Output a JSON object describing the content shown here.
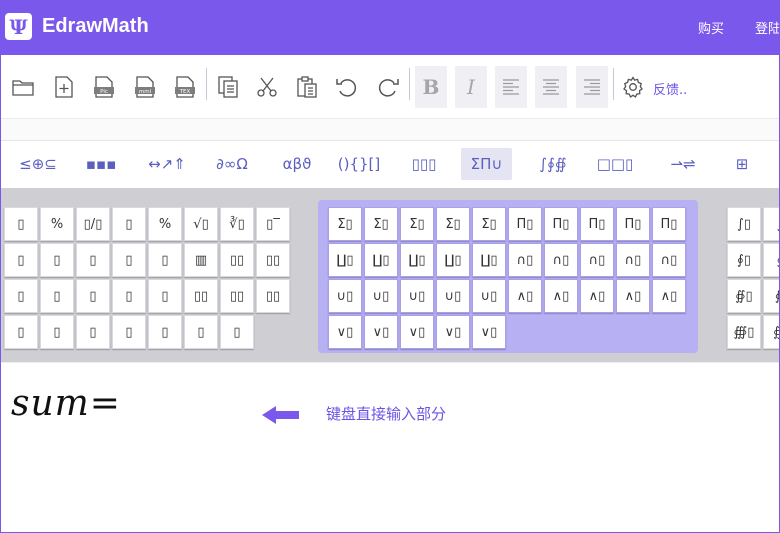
{
  "header": {
    "logo_glyph": "Ψ",
    "title": "EdrawMath",
    "buy_label": "购买",
    "login_label": "登陆",
    "accent": "#7b58ec"
  },
  "toolbar": {
    "icons": [
      "folder-icon",
      "new-file-icon",
      "export-pic-icon",
      "export-mml-icon",
      "export-tex-icon",
      "copy-icon",
      "cut-icon",
      "paste-icon",
      "undo-icon",
      "redo-icon",
      "bold-icon",
      "italic-icon",
      "align-left-icon",
      "align-center-icon",
      "align-right-icon",
      "settings-icon"
    ],
    "bold_label": "B",
    "italic_label": "I",
    "feedback_label": "反馈.."
  },
  "categories": [
    {
      "label": "≤⊕⊆"
    },
    {
      "label": "▪▪▪"
    },
    {
      "label": "↔↗⇑"
    },
    {
      "label": "∂∞Ω"
    },
    {
      "label": "αβϑ"
    },
    {
      "label": "(){}[]"
    },
    {
      "label": "▯▯▯"
    },
    {
      "label": "ΣΠ∪",
      "active": true
    },
    {
      "label": "∫∮∯"
    },
    {
      "label": "□□▯"
    },
    {
      "label": "⇀⇌"
    },
    {
      "label": "⊞"
    }
  ],
  "palette": {
    "left": [
      [
        "▯",
        "%",
        "▯/▯",
        "▯",
        "%",
        "√▯",
        "∛▯",
        "▯‾"
      ],
      [
        "▯",
        "▯",
        "▯",
        "▯",
        "▯",
        "▥",
        "▯▯",
        "▯▯"
      ],
      [
        "▯",
        "▯",
        "▯",
        "▯",
        "▯",
        "▯▯",
        "▯▯",
        "▯▯"
      ],
      [
        "▯",
        "▯",
        "▯",
        "▯",
        "▯",
        "▯",
        "▯"
      ]
    ],
    "middle": [
      [
        "Σ▯",
        "Σ▯",
        "Σ▯",
        "Σ▯",
        "Σ▯",
        "Π▯",
        "Π▯",
        "Π▯",
        "Π▯",
        "Π▯"
      ],
      [
        "∐▯",
        "∐▯",
        "∐▯",
        "∐▯",
        "∐▯",
        "∩▯",
        "∩▯",
        "∩▯",
        "∩▯",
        "∩▯"
      ],
      [
        "∪▯",
        "∪▯",
        "∪▯",
        "∪▯",
        "∪▯",
        "∧▯",
        "∧▯",
        "∧▯",
        "∧▯",
        "∧▯"
      ],
      [
        "∨▯",
        "∨▯",
        "∨▯",
        "∨▯",
        "∨▯"
      ]
    ],
    "right": [
      [
        "∫▯",
        "∫"
      ],
      [
        "∮▯",
        "∮"
      ],
      [
        "∯▯",
        "∯"
      ],
      [
        "∰▯",
        "∰"
      ]
    ]
  },
  "editor": {
    "formula_var": "sum",
    "formula_eq": "=",
    "hint": "键盘直接输入部分"
  }
}
